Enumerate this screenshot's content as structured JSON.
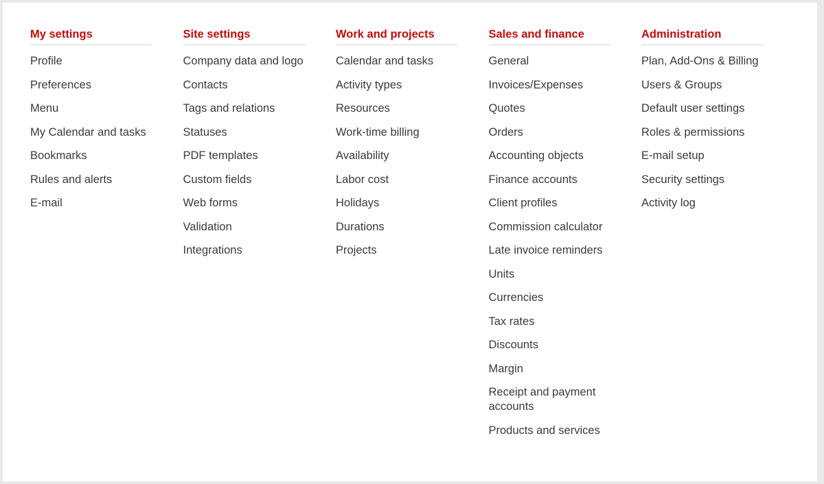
{
  "colors": {
    "heading": "#c00d0d",
    "link": "#3a3a3a",
    "divider": "#d6d6d6"
  },
  "columns": [
    {
      "title": "My settings",
      "items": [
        "Profile",
        "Preferences",
        "Menu",
        "My Calendar and tasks",
        "Bookmarks",
        "Rules and alerts",
        "E-mail"
      ]
    },
    {
      "title": "Site settings",
      "items": [
        "Company data and logo",
        "Contacts",
        "Tags and relations",
        "Statuses",
        "PDF templates",
        "Custom fields",
        "Web forms",
        "Validation",
        "Integrations"
      ]
    },
    {
      "title": "Work and projects",
      "items": [
        "Calendar and tasks",
        "Activity types",
        "Resources",
        "Work-time billing",
        "Availability",
        "Labor cost",
        "Holidays",
        "Durations",
        "Projects"
      ]
    },
    {
      "title": "Sales and finance",
      "items": [
        "General",
        "Invoices/Expenses",
        "Quotes",
        "Orders",
        "Accounting objects",
        "Finance accounts",
        "Client profiles",
        "Commission calculator",
        "Late invoice reminders",
        "Units",
        "Currencies",
        "Tax rates",
        "Discounts",
        "Margin",
        "Receipt and payment accounts",
        "Products and services"
      ]
    },
    {
      "title": "Administration",
      "items": [
        "Plan, Add-Ons & Billing",
        "Users & Groups",
        "Default user settings",
        "Roles & permissions",
        "E-mail setup",
        "Security settings",
        "Activity log"
      ]
    }
  ]
}
